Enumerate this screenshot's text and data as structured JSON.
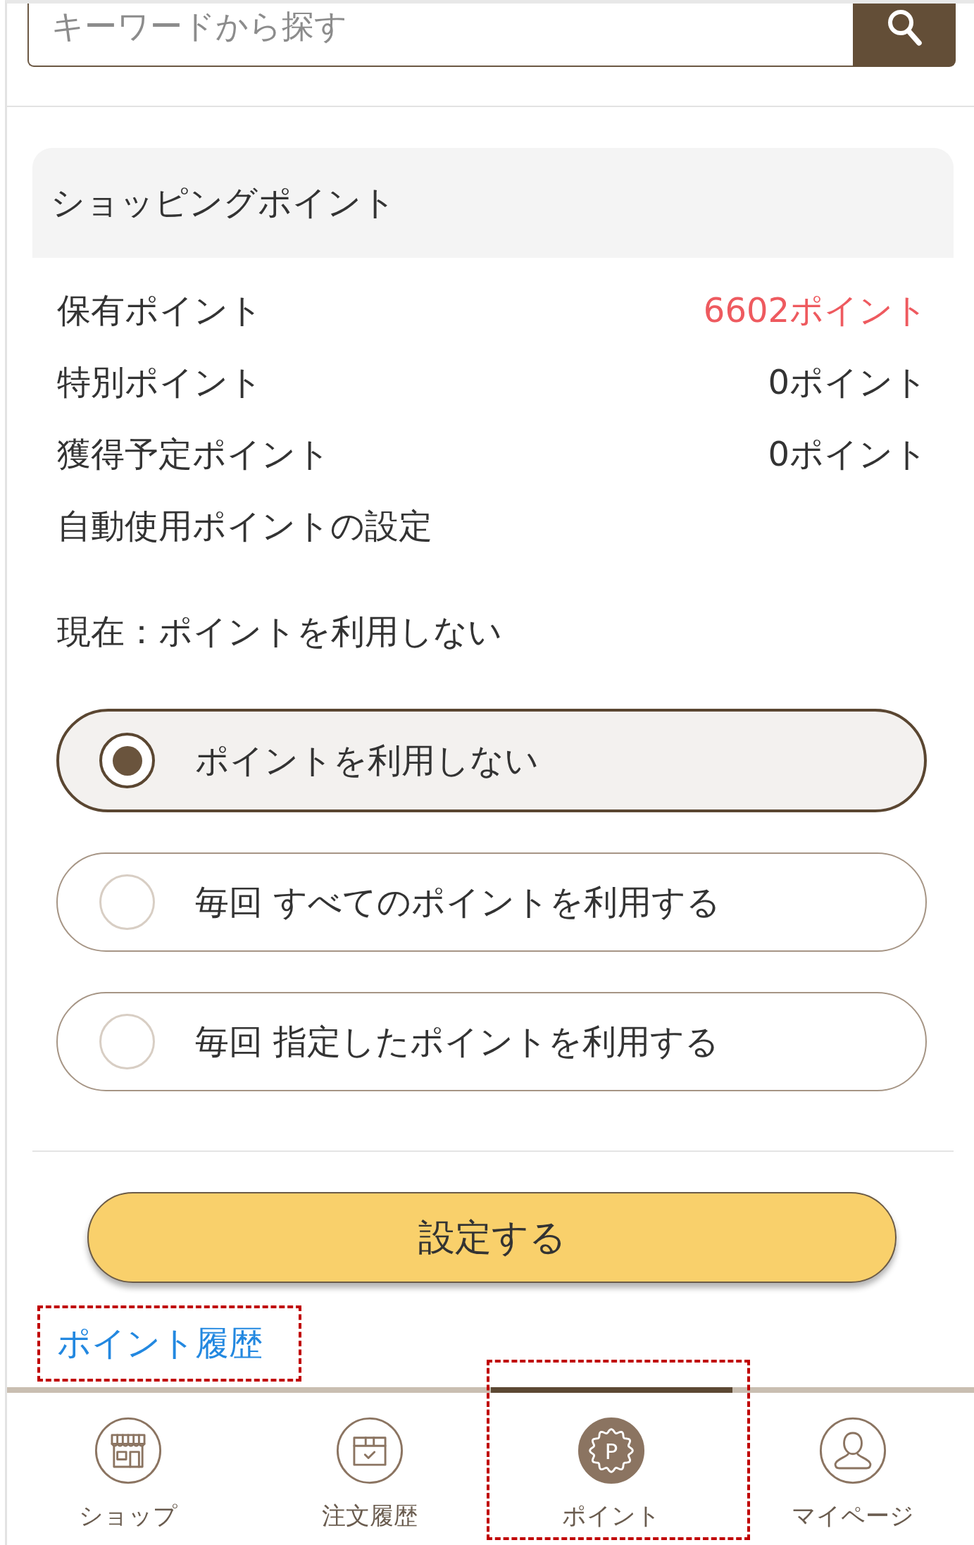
{
  "search": {
    "placeholder": "キーワードから探す"
  },
  "points_card": {
    "title": "ショッピングポイント",
    "rows": [
      {
        "label": "保有ポイント",
        "value": "6602ポイント",
        "color": "#ee5a5f"
      },
      {
        "label": "特別ポイント",
        "value": "0ポイント",
        "color": "#333333"
      },
      {
        "label": "獲得予定ポイント",
        "value": "0ポイント",
        "color": "#333333"
      }
    ],
    "auto_use": {
      "title": "自動使用ポイントの設定",
      "current": "現在：ポイントを利用しない",
      "options": [
        {
          "label": "ポイントを利用しない",
          "selected": true
        },
        {
          "label": "毎回 すべてのポイントを利用する",
          "selected": false
        },
        {
          "label": "毎回 指定したポイントを利用する",
          "selected": false
        }
      ],
      "submit": "設定する"
    },
    "history_link": {
      "label": "ポイント履歴",
      "highlighted": true
    }
  },
  "bottom_nav": [
    {
      "kind": "shop",
      "label": "ショップ",
      "selected": false,
      "highlighted": false
    },
    {
      "kind": "orders",
      "label": "注文履歴",
      "selected": false,
      "highlighted": false
    },
    {
      "kind": "points",
      "label": "ポイント",
      "icon_text": "P",
      "selected": true,
      "highlighted": true
    },
    {
      "kind": "account",
      "label": "マイページ",
      "selected": false,
      "highlighted": false
    }
  ]
}
